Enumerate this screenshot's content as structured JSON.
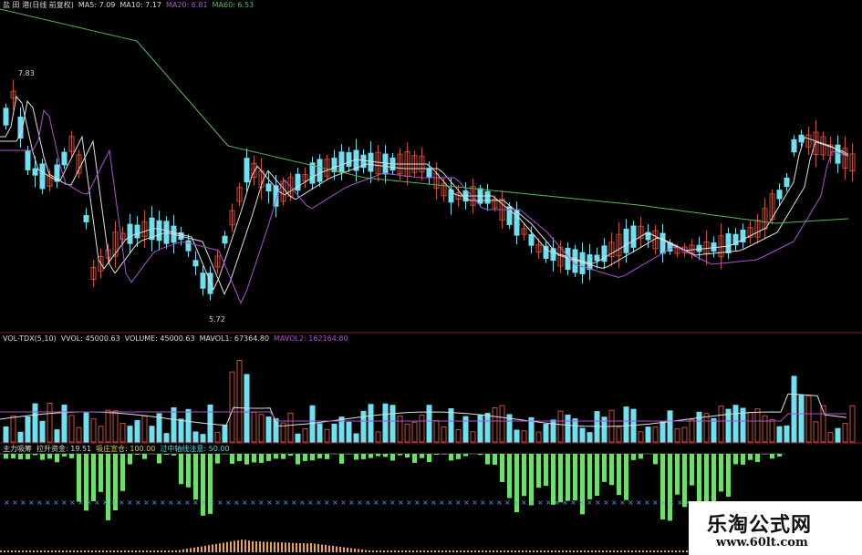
{
  "main_panel": {
    "title": "盐 田 港(日线 前复权)",
    "ma5": "MA5: 7.09",
    "ma10": "MA10: 7.17",
    "ma20": "MA20: 6.81",
    "ma60": "MA60: 6.53",
    "high_label": "7.83",
    "low_label": "5.72",
    "ma_colors": {
      "ma5": "#e0e0e0",
      "ma10": "#e0e0e0",
      "ma20": "#b050d0",
      "ma60": "#58b858"
    },
    "up_color": "#c8503a",
    "down_color": "#6fe0f0"
  },
  "volume_panel": {
    "title": "VOL-TDX(5,10)",
    "vvol": "VVOL: 45000.63",
    "volume": "VOLUME: 45000.63",
    "mavol1": "MAVOL1: 67364.80",
    "mavol2": "MAVOL2: 162164.80"
  },
  "indicator_panel": {
    "title": "主力吸筹",
    "pull_funds": "拉升资金: 19.51",
    "control": "吸庄宣仓: 100.00",
    "break_notice": "过中轴线注意: 50.00"
  },
  "watermark": {
    "title": "乐淘公式网",
    "url": "www.60lt.com"
  }
}
